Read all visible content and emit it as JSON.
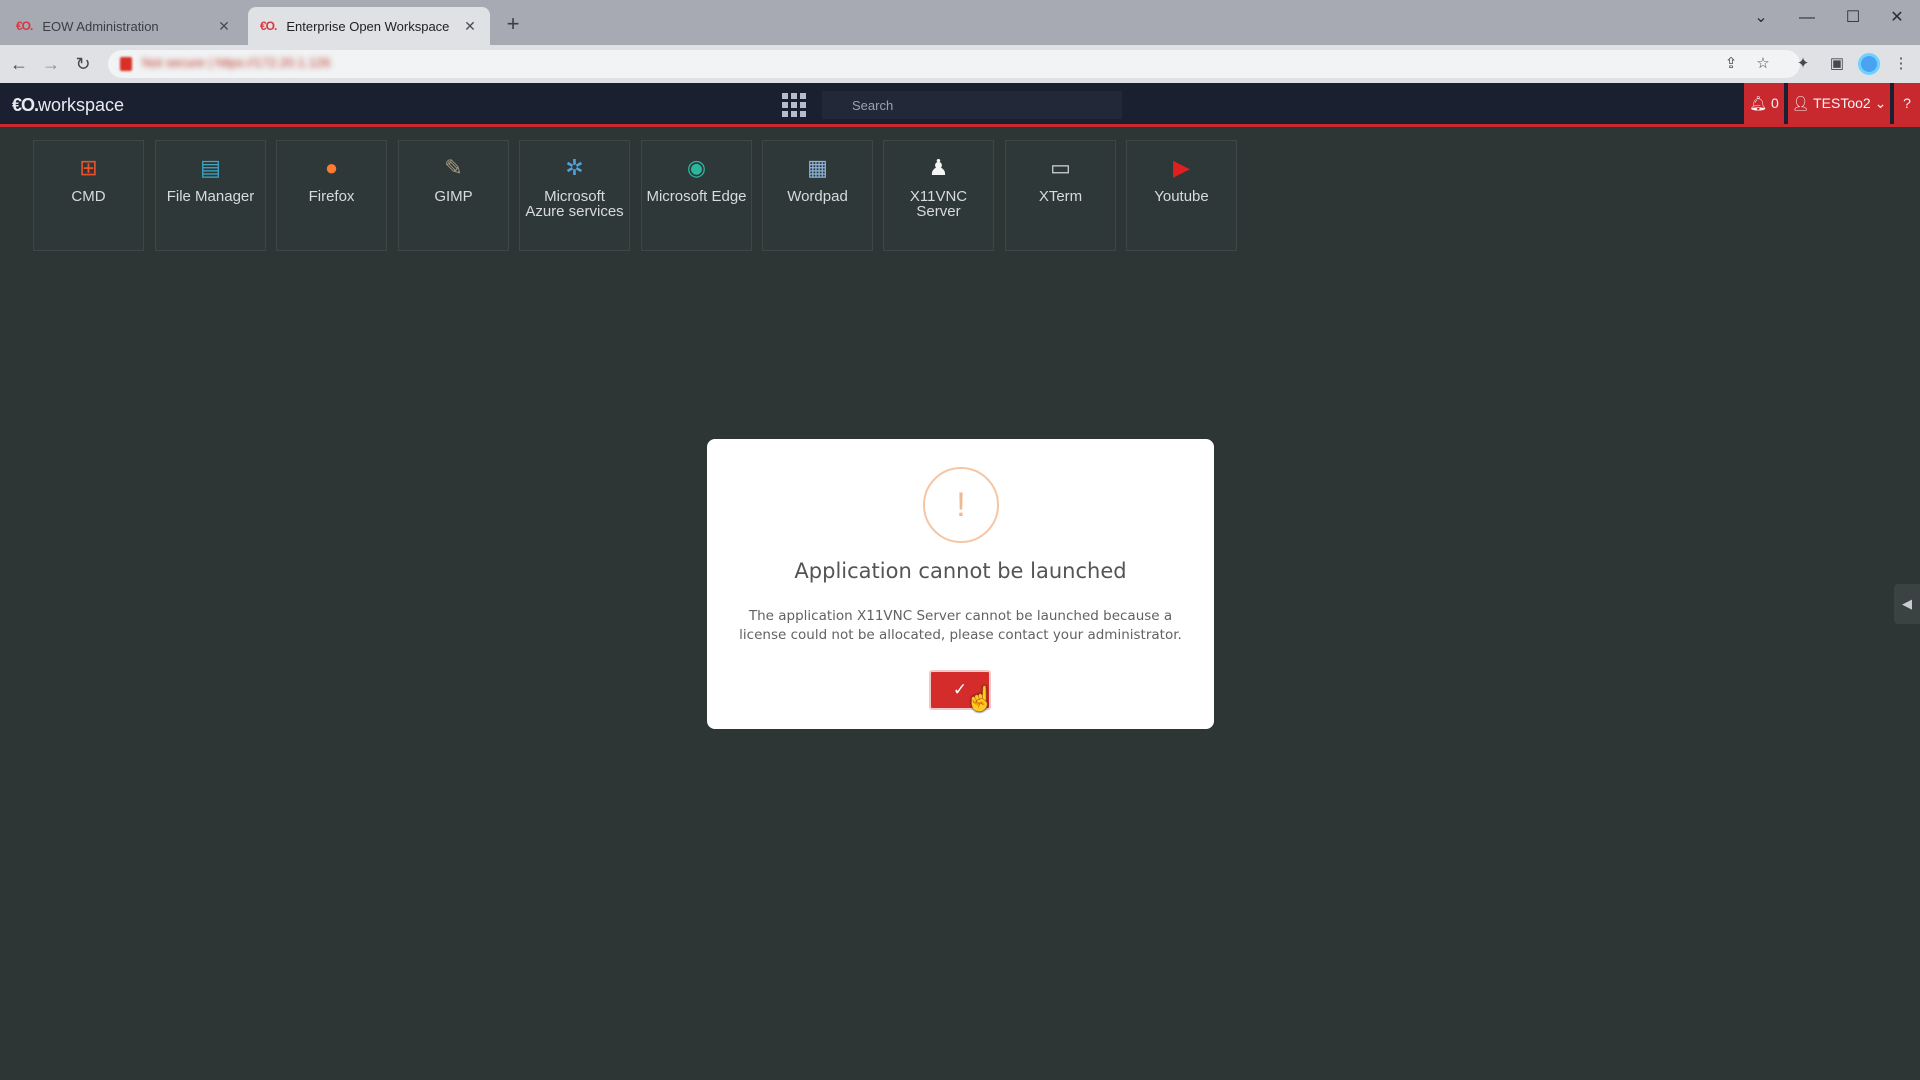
{
  "browser": {
    "tabs": [
      {
        "favicon": "eo-icon",
        "label": "EOW Administration"
      },
      {
        "favicon": "eo-icon",
        "label": "Enterprise Open Workspace"
      }
    ],
    "new_tab": "+",
    "window_controls": {
      "dropdown": "⌄",
      "minimize": "—",
      "maximize": "☐",
      "close": "✕"
    },
    "url_blurred": "Not secure | https://172.20.1.126"
  },
  "app": {
    "brand_mark": "€O.",
    "brand_text": "workspace",
    "search_placeholder": "Search",
    "notifications_count": "0",
    "username": "TESToo2",
    "accent_color": "#c8292e"
  },
  "tiles": [
    {
      "name": "CMD",
      "icon": "windows-icon"
    },
    {
      "name": "File Manager",
      "icon": "file-manager-icon"
    },
    {
      "name": "Firefox",
      "icon": "firefox-icon"
    },
    {
      "name": "GIMP",
      "icon": "gimp-icon"
    },
    {
      "name": "Microsoft Azure services",
      "icon": "azure-icon"
    },
    {
      "name": "Microsoft Edge",
      "icon": "edge-icon"
    },
    {
      "name": "Wordpad",
      "icon": "wordpad-icon"
    },
    {
      "name": "X11VNC Server",
      "icon": "linux-penguin-icon"
    },
    {
      "name": "XTerm",
      "icon": "terminal-icon"
    },
    {
      "name": "Youtube",
      "icon": "youtube-icon"
    }
  ],
  "dialog": {
    "icon": "!",
    "title": "Application cannot be launched",
    "message": "The application X11VNC Server cannot be launched because a license could not be allocated, please contact your administrator.",
    "confirm_label": "✓"
  }
}
